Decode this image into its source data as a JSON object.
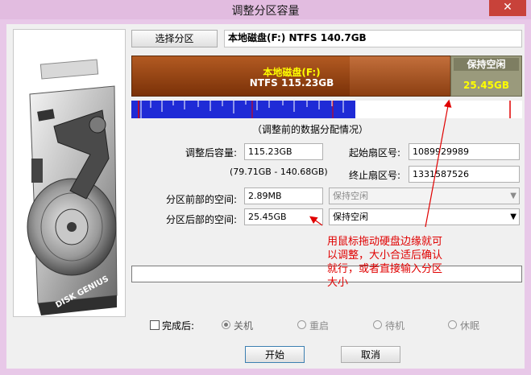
{
  "window": {
    "title": "调整分区容量",
    "close_glyph": "✕"
  },
  "left_panel": {
    "brand_text": "DISK GENIUS"
  },
  "partition": {
    "select_button": "选择分区",
    "header_value": "本地磁盘(F:) NTFS 140.7GB",
    "bar_name": "本地磁盘(F:)",
    "bar_size": "NTFS 115.23GB",
    "free_name": "保持空闲",
    "free_size": "25.45GB",
    "map_caption": "（调整前的数据分配情况）",
    "colors": {
      "partition_bar": "#8a3b10",
      "free_block": "#9a9a7c",
      "free_text": "#ffff00",
      "map_blue": "#1f2bd6"
    }
  },
  "form": {
    "size_label": "调整后容量:",
    "size_value": "115.23GB",
    "range_text": "(79.71GB - 140.68GB)",
    "start_sector_label": "起始扇区号:",
    "start_sector_value": "1089929989",
    "end_sector_label": "终止扇区号:",
    "end_sector_value": "1331587526",
    "before_label": "分区前部的空间:",
    "before_value": "2.89MB",
    "before_option": "保持空闲",
    "after_label": "分区后部的空间:",
    "after_value": "25.45GB",
    "after_option": "保持空闲"
  },
  "annotation": {
    "line1": "用鼠标拖动硬盘边缘就可",
    "line2": "以调整，大小合适后确认",
    "line3": "就行，或者直接输入分区",
    "line4": "大小",
    "color": "#e00000"
  },
  "completion": {
    "checkbox_label": "完成后:",
    "options": [
      "关机",
      "重启",
      "待机",
      "休眠"
    ],
    "selected": "关机"
  },
  "buttons": {
    "start": "开始",
    "cancel": "取消"
  }
}
